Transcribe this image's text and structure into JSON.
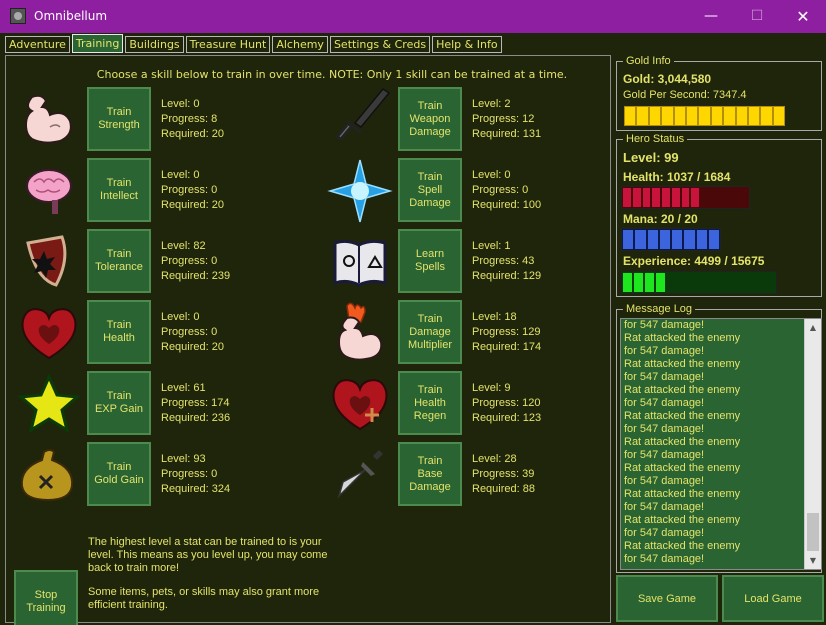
{
  "window": {
    "title": "Omnibellum",
    "minimize": "—",
    "maximize": "☐",
    "close": "✕"
  },
  "tabs": [
    "Adventure",
    "Training",
    "Buildings",
    "Treasure Hunt",
    "Alchemy",
    "Settings & Creds",
    "Help & Info"
  ],
  "active_tab": "Training",
  "instructions": "Choose a skill below to train in over time. NOTE: Only 1 skill can be trained at a time.",
  "skills": [
    {
      "icon": "arm-icon",
      "button": [
        "Train",
        "Strength"
      ],
      "level": "Level: 0",
      "progress": "Progress: 8",
      "required": "Required: 20"
    },
    {
      "icon": "brain-icon",
      "button": [
        "Train",
        "Intellect"
      ],
      "level": "Level: 0",
      "progress": "Progress: 0",
      "required": "Required: 20"
    },
    {
      "icon": "shield-icon",
      "button": [
        "Train",
        "Tolerance"
      ],
      "level": "Level: 82",
      "progress": "Progress: 0",
      "required": "Required: 239"
    },
    {
      "icon": "heart-icon",
      "button": [
        "Train",
        "Health"
      ],
      "level": "Level: 0",
      "progress": "Progress: 0",
      "required": "Required: 20"
    },
    {
      "icon": "star-icon",
      "button": [
        "Train",
        "EXP Gain"
      ],
      "level": "Level: 61",
      "progress": "Progress: 174",
      "required": "Required: 236"
    },
    {
      "icon": "gold-bag-icon",
      "button": [
        "Train",
        "Gold Gain"
      ],
      "level": "Level: 93",
      "progress": "Progress: 0",
      "required": "Required: 324"
    },
    {
      "icon": "sword-icon",
      "button": [
        "Train",
        "Weapon",
        "Damage"
      ],
      "level": "Level: 2",
      "progress": "Progress: 12",
      "required": "Required: 131"
    },
    {
      "icon": "spell-star-icon",
      "button": [
        "Train",
        "Spell",
        "Damage"
      ],
      "level": "Level: 0",
      "progress": "Progress: 0",
      "required": "Required: 100"
    },
    {
      "icon": "spellbook-icon",
      "button": [
        "Learn",
        "Spells"
      ],
      "level": "Level: 1",
      "progress": "Progress: 43",
      "required": "Required: 129"
    },
    {
      "icon": "flaming-arm-icon",
      "button": [
        "Train",
        "Damage",
        "Multiplier"
      ],
      "level": "Level: 18",
      "progress": "Progress: 129",
      "required": "Required: 174"
    },
    {
      "icon": "heart-plus-icon",
      "button": [
        "Train",
        "Health",
        "Regen"
      ],
      "level": "Level: 9",
      "progress": "Progress: 120",
      "required": "Required: 123"
    },
    {
      "icon": "dagger-icon",
      "button": [
        "Train",
        "Base",
        "Damage"
      ],
      "level": "Level: 28",
      "progress": "Progress: 39",
      "required": "Required: 88"
    }
  ],
  "stop_button": [
    "Stop",
    "Training"
  ],
  "notes": {
    "level_cap": "The highest level a stat can be trained to is your level. This means as you level up, you may come back to train more!",
    "items": "Some items, pets, or skills may also grant more efficient training."
  },
  "gold_info": {
    "legend": "Gold Info",
    "gold": "Gold: 3,044,580",
    "gps": "Gold Per Second: 7347.4",
    "bar_fill": 0.97,
    "bar_color": "#ffd700"
  },
  "hero_status": {
    "legend": "Hero Status",
    "level": "Level: 99",
    "health": "Health: 1037 / 1684",
    "health_fraction": 0.616,
    "health_color": "#c8143c",
    "mana": "Mana: 20 / 20",
    "mana_fraction": 1.0,
    "mana_color": "#3c64dc",
    "experience": "Experience: 4499 / 15675",
    "exp_fraction": 0.287,
    "exp_color": "#1ee61e"
  },
  "message_log": {
    "legend": "Message Log",
    "lines": [
      "for 547 damage!",
      "Rat attacked the enemy",
      "for 547 damage!",
      "Rat attacked the enemy",
      "for 547 damage!",
      "Rat attacked the enemy",
      "for 547 damage!",
      "Rat attacked the enemy",
      "for 547 damage!",
      "Rat attacked the enemy",
      "for 547 damage!",
      "Rat attacked the enemy",
      "for 547 damage!",
      "Rat attacked the enemy",
      "for 547 damage!",
      "Rat attacked the enemy",
      "for 547 damage!",
      "Rat attacked the enemy",
      "for 547 damage!"
    ]
  },
  "save_button": "Save Game",
  "load_button": "Load Game",
  "colors": {
    "titlebar": "#8e1fa0",
    "background": "#1f250b",
    "button": "#2b6433",
    "text": "#e3e36a"
  }
}
